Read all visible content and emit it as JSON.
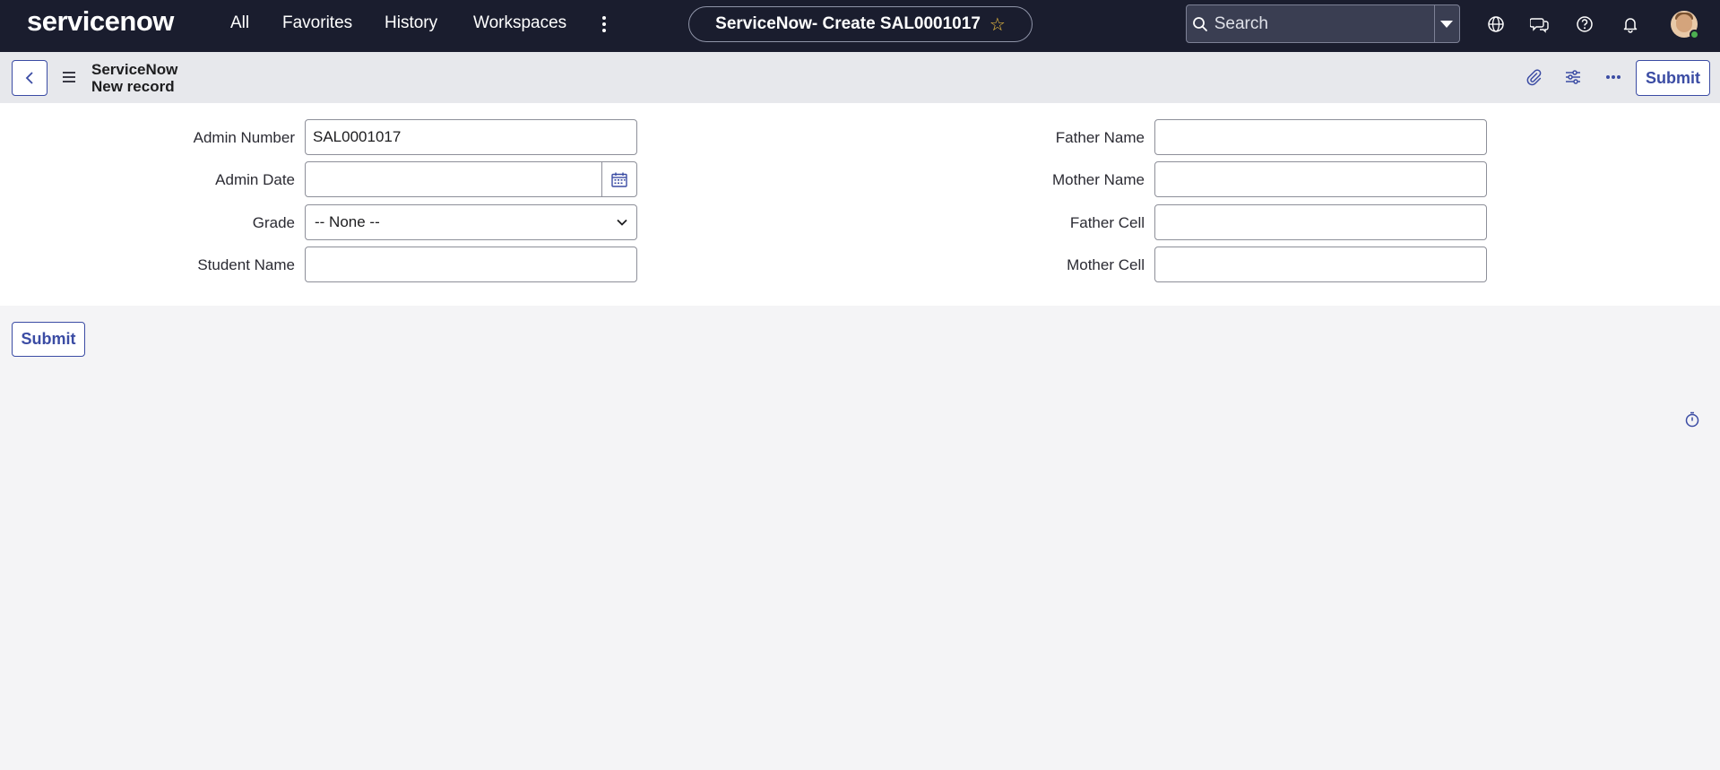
{
  "app": {
    "brand": "servicenow",
    "nav_items": [
      "All",
      "Favorites",
      "History",
      "Workspaces"
    ],
    "page_title": "ServiceNow- Create SAL0001017",
    "search": {
      "placeholder": "Search"
    },
    "colors": {
      "nav_bg": "#1a1d2e",
      "accent": "#3b4ca4",
      "favorite_star": "#f5c542",
      "online_status": "#4caf50"
    }
  },
  "header": {
    "breadcrumb_app": "ServiceNow",
    "breadcrumb_record": "New record",
    "submit_label": "Submit"
  },
  "form": {
    "left": [
      {
        "label": "Admin Number",
        "value": "SAL0001017"
      },
      {
        "label": "Admin Date",
        "value": ""
      },
      {
        "label": "Grade",
        "value": "-- None --"
      },
      {
        "label": "Student Name",
        "value": ""
      }
    ],
    "right": [
      {
        "label": "Father Name",
        "value": ""
      },
      {
        "label": "Mother Name",
        "value": ""
      },
      {
        "label": "Father Cell",
        "value": ""
      },
      {
        "label": "Mother Cell",
        "value": ""
      }
    ]
  },
  "footer": {
    "submit_label": "Submit"
  },
  "icons": [
    "search-icon",
    "dropdown-arrow-icon",
    "globe-icon",
    "chat-icon",
    "help-icon",
    "bell-icon",
    "back-icon",
    "menu-icon",
    "attachment-icon",
    "settings-icon",
    "more-icon",
    "calendar-icon",
    "chevron-down-icon",
    "star-icon",
    "timer-icon"
  ]
}
